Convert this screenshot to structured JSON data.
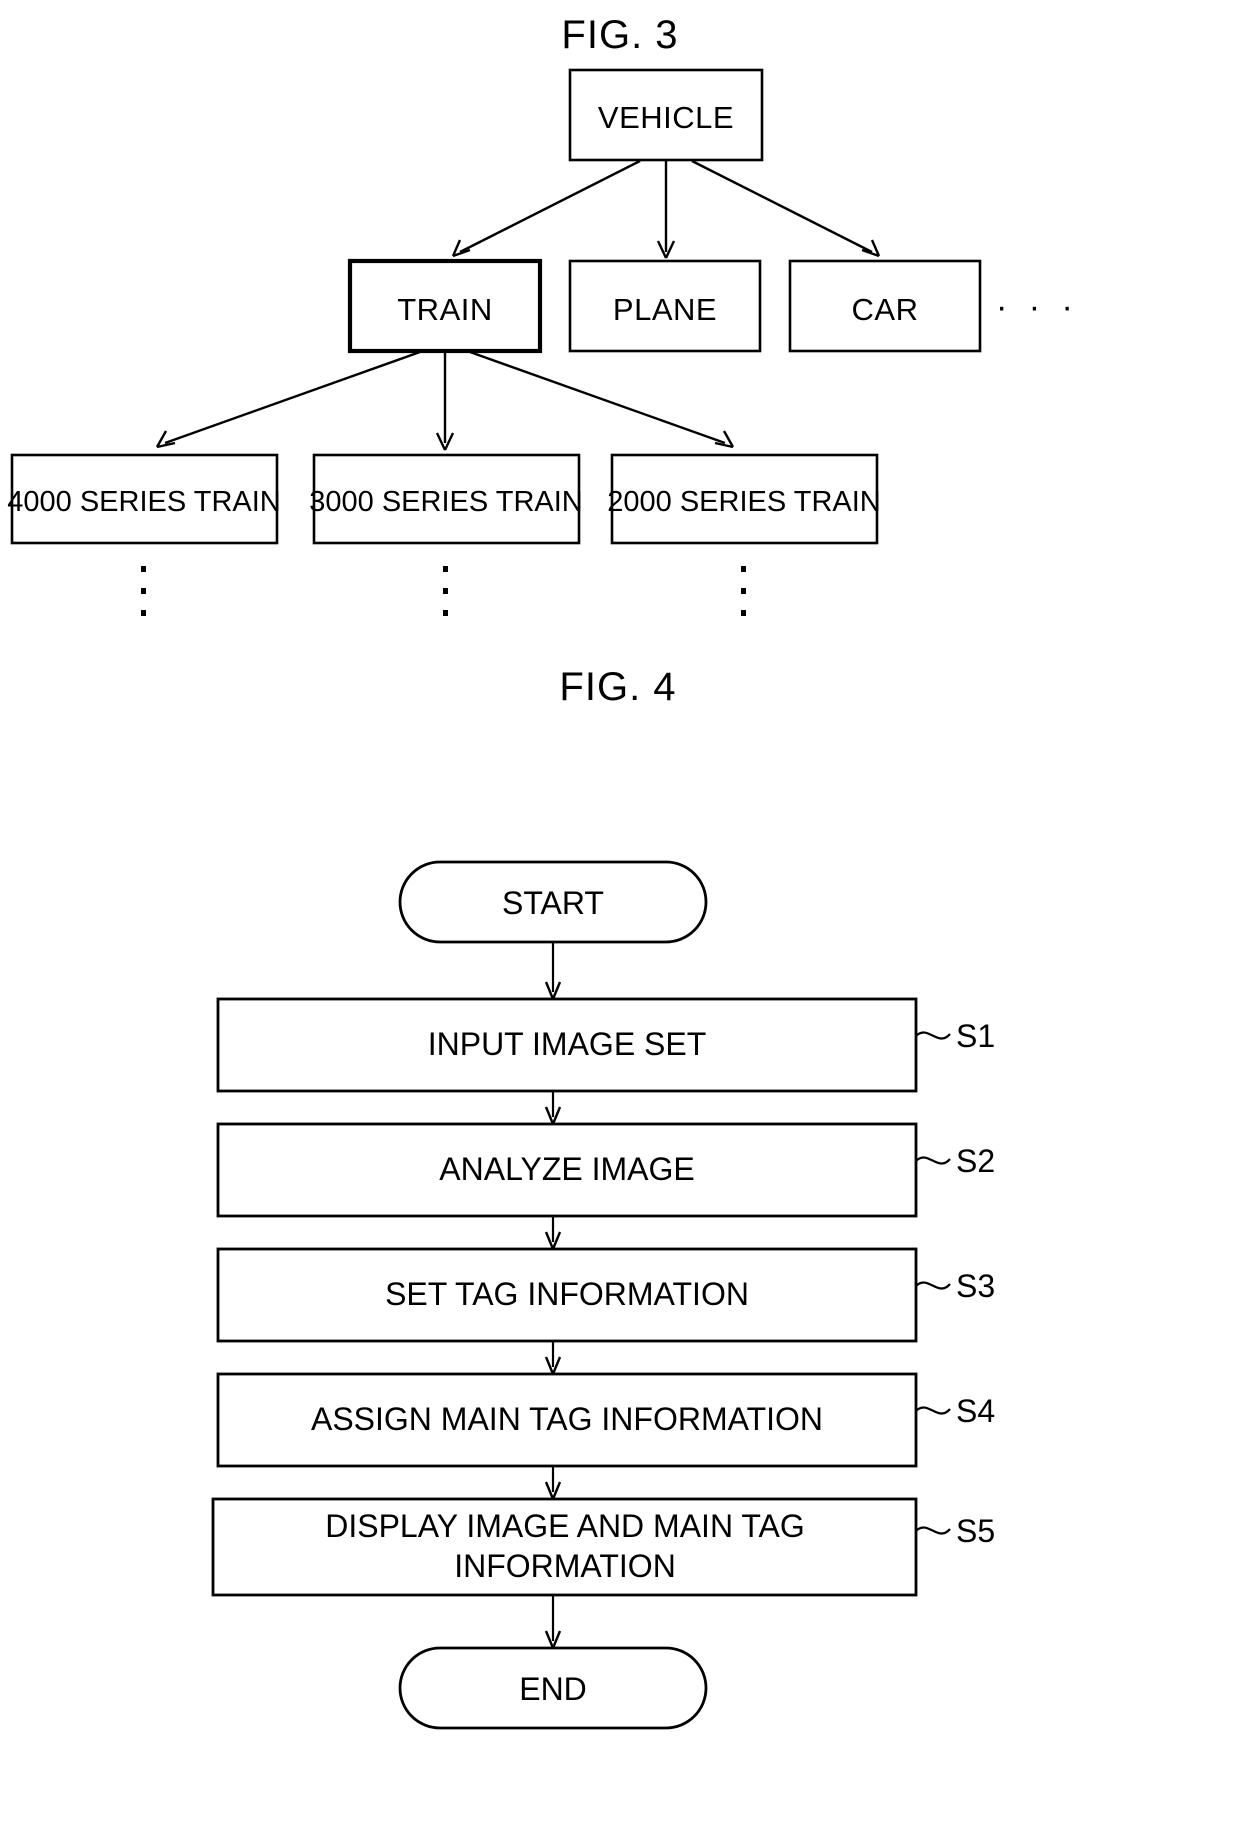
{
  "figure3": {
    "title": "FIG. 3",
    "root": {
      "label": "VEHICLE"
    },
    "level2": [
      {
        "label": "TRAIN",
        "highlighted": true
      },
      {
        "label": "PLANE",
        "highlighted": false
      },
      {
        "label": "CAR",
        "highlighted": false
      }
    ],
    "level2_ellipsis": "· · ·",
    "level3": [
      {
        "label": "4000 SERIES TRAIN"
      },
      {
        "label": "3000 SERIES TRAIN"
      },
      {
        "label": "2000 SERIES TRAIN"
      }
    ],
    "level3_vertical_ellipsis_count": 3
  },
  "figure4": {
    "title": "FIG. 4",
    "start": {
      "label": "START"
    },
    "end": {
      "label": "END"
    },
    "steps": [
      {
        "label": "INPUT IMAGE SET",
        "step_id": "S1",
        "lines": [
          "INPUT IMAGE SET"
        ]
      },
      {
        "label": "ANALYZE IMAGE",
        "step_id": "S2",
        "lines": [
          "ANALYZE IMAGE"
        ]
      },
      {
        "label": "SET TAG INFORMATION",
        "step_id": "S3",
        "lines": [
          "SET TAG INFORMATION"
        ]
      },
      {
        "label": "ASSIGN MAIN TAG INFORMATION",
        "step_id": "S4",
        "lines": [
          "ASSIGN MAIN TAG INFORMATION"
        ]
      },
      {
        "label": "DISPLAY IMAGE AND MAIN TAG INFORMATION",
        "step_id": "S5",
        "lines": [
          "DISPLAY IMAGE AND MAIN TAG",
          "INFORMATION"
        ]
      }
    ]
  },
  "colors": {
    "ink": "#000000",
    "paper": "#ffffff"
  }
}
